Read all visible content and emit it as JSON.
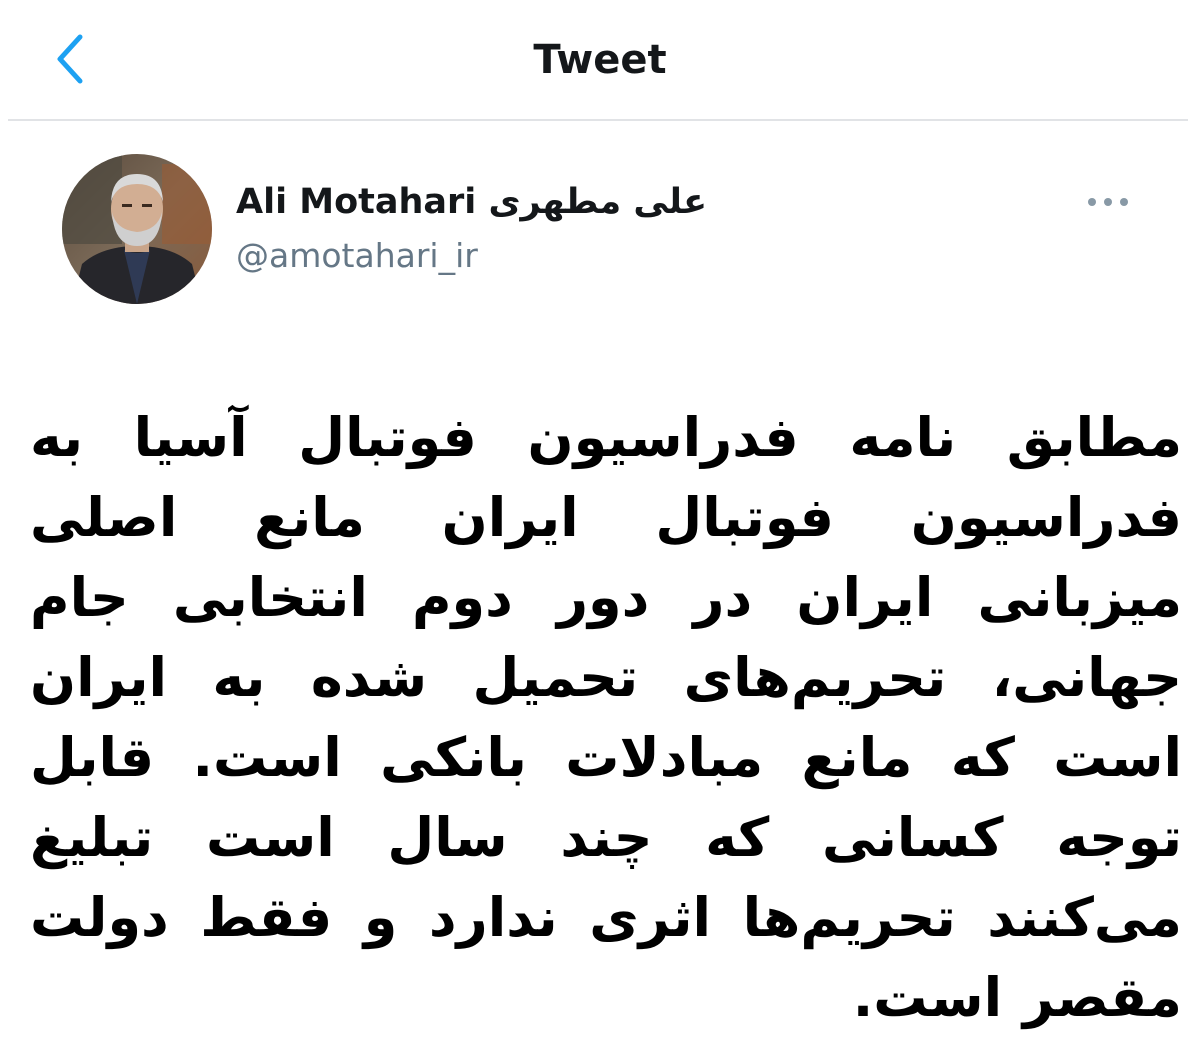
{
  "header": {
    "title": "Tweet",
    "back_icon": "chevron-left-icon"
  },
  "tweet": {
    "author": {
      "display_name": "Ali Motahari علی مطهری",
      "handle": "@amotahari_ir",
      "avatar_icon": "avatar"
    },
    "more_icon": "more-horizontal-icon",
    "text": "مطابق نامه فدراسیون فوتبال آسیا به فدراسیون فوتبال ایران مانع اصلی میزبانی ایران در دور دوم انتخابی جام جهانی، تحریم‌های تحمیل شده به ایران است که مانع مبادلات بانکی است. قابل توجه کسانی که چند سال است تبلیغ می‌کنند تحریم‌ها اثری ندارد و فقط دولت مقصر است."
  },
  "colors": {
    "accent": "#1da1f2",
    "text_primary": "#14171a",
    "text_secondary": "#657786",
    "divider": "#e1e3e6"
  }
}
